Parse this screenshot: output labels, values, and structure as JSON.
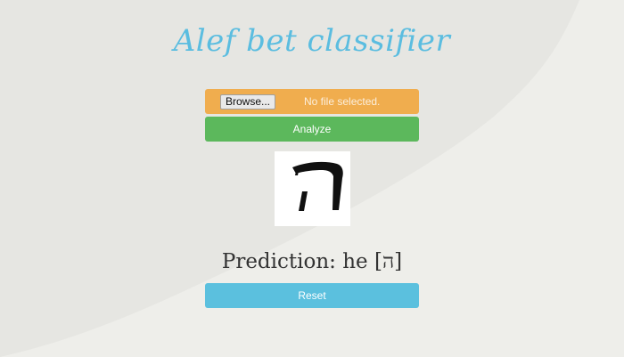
{
  "header": {
    "title": "Alef bet classifier"
  },
  "upload": {
    "browse_label": "Browse...",
    "status_text": "No file selected."
  },
  "actions": {
    "analyze_label": "Analyze",
    "reset_label": "Reset"
  },
  "result": {
    "prediction_label": "Prediction:",
    "prediction_value": "he [ה]"
  },
  "colors": {
    "title": "#5bbde0",
    "file_bar": "#f0ad4e",
    "analyze": "#5cb85c",
    "reset": "#5bc0de",
    "background": "#eeeeea"
  },
  "icons": {
    "preview": "hebrew-letter-he-image"
  }
}
